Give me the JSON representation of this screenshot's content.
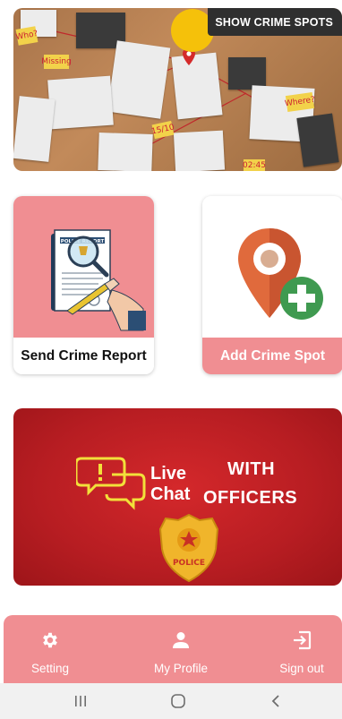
{
  "banner": {
    "show_crime_spots_label": "SHOW CRIME SPOTS",
    "sticky_notes": [
      "Who?",
      "Missing",
      "15/10",
      "Where?",
      "02:45"
    ]
  },
  "cards": {
    "send_report": {
      "label": "Send Crime Report",
      "doc_title": "POLICE REPORT"
    },
    "add_spot": {
      "label": "Add Crime Spot"
    }
  },
  "live_chat": {
    "live": "Live",
    "chat": "Chat",
    "with": "WITH",
    "officers": "OFFICERS",
    "badge_text": "POLICE"
  },
  "bottom_nav": {
    "setting": "Setting",
    "profile": "My Profile",
    "signout": "Sign out"
  },
  "colors": {
    "accent": "#f08e92",
    "chat_bg": "#c1222a",
    "badge_yellow": "#f5c10a"
  }
}
